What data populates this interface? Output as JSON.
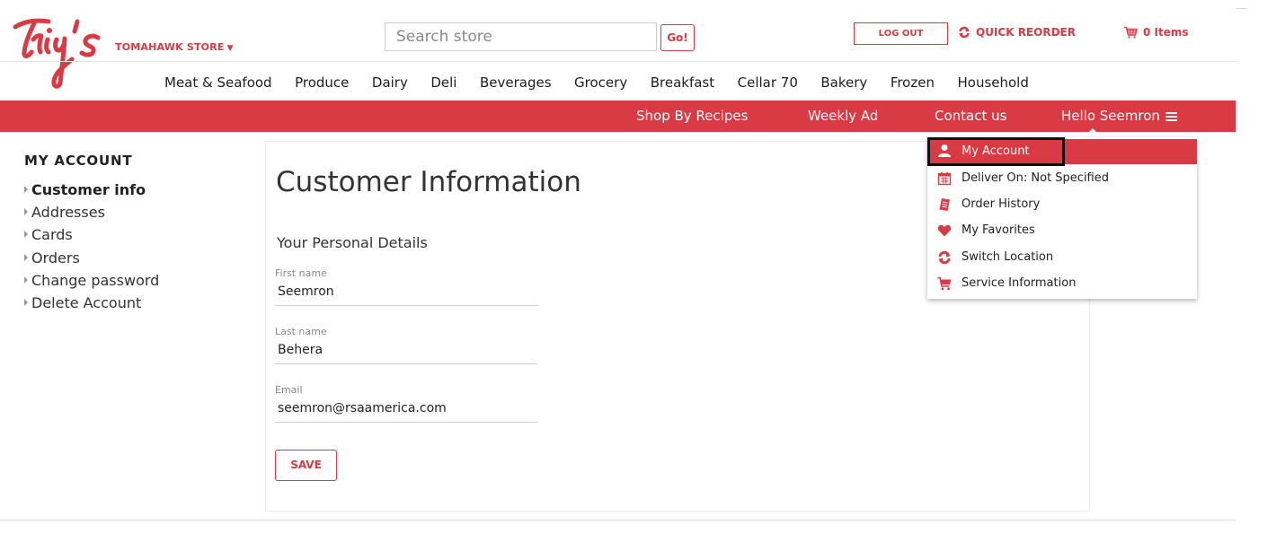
{
  "header": {
    "store_name": "TOMAHAWK STORE",
    "search_placeholder": "Search store",
    "go_label": "Go!",
    "logout_label": "LOG OUT",
    "quick_reorder_label": "QUICK REORDER",
    "cart_label": "0 Items"
  },
  "categories": [
    "Meat & Seafood",
    "Produce",
    "Dairy",
    "Deli",
    "Beverages",
    "Grocery",
    "Breakfast",
    "Cellar 70",
    "Bakery",
    "Frozen",
    "Household"
  ],
  "redbar": {
    "shop_by_recipes": "Shop By Recipes",
    "weekly_ad": "Weekly Ad",
    "contact_us": "Contact us",
    "hello_user": "Hello Seemron"
  },
  "sidebar": {
    "title": "MY ACCOUNT",
    "items": [
      {
        "label": "Customer info",
        "active": true
      },
      {
        "label": "Addresses"
      },
      {
        "label": "Cards"
      },
      {
        "label": "Orders"
      },
      {
        "label": "Change password"
      },
      {
        "label": "Delete Account"
      }
    ]
  },
  "main": {
    "title": "Customer Information",
    "section_title": "Your Personal Details",
    "fields": {
      "first_name": {
        "label": "First name",
        "value": "Seemron"
      },
      "last_name": {
        "label": "Last name",
        "value": "Behera"
      },
      "email": {
        "label": "Email",
        "value": "seemron@rsaamerica.com"
      }
    },
    "save_label": "SAVE"
  },
  "account_menu": {
    "items": [
      {
        "label": "My Account",
        "icon": "user-icon",
        "highlighted": true
      },
      {
        "label": "Deliver On:  Not Specified",
        "icon": "calendar-icon"
      },
      {
        "label": "Order History",
        "icon": "receipt-icon"
      },
      {
        "label": "My Favorites",
        "icon": "heart-icon"
      },
      {
        "label": "Switch Location",
        "icon": "switch-icon"
      },
      {
        "label": "Service Information",
        "icon": "cart-icon"
      }
    ]
  },
  "colors": {
    "accent": "#d93a43",
    "highlight_border": "#111111"
  }
}
